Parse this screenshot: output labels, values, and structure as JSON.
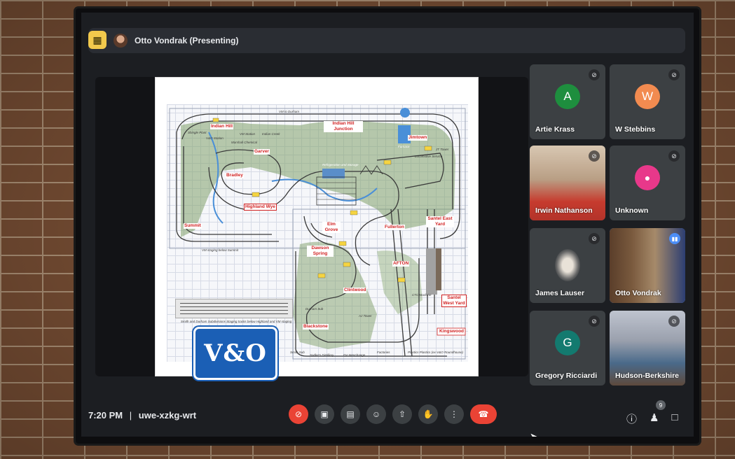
{
  "presenter_bar": {
    "name": "Otto Vondrak (Presenting)"
  },
  "slide": {
    "labels": {
      "indian_hill": "Indian Hill",
      "indian_hill_junction": "Indian Hill Junction",
      "jimtown": "Jimtown",
      "garver": "Garver",
      "bradley": "Bradley",
      "highland_wye": "Highland Wye",
      "summit": "Summit",
      "elm_grove": "Elm Grove",
      "fullerton": "Fullerton",
      "santel_east_yard": "Santel East Yard",
      "dawson_spring": "Dawson Spring",
      "afton": "AFTON",
      "clintwood": "Clintwood",
      "santel_west_yard": "Santel West Yard",
      "blackstone": "Blackstone",
      "kingswood": "Kingswood"
    },
    "notes": {
      "vm_to_durham": "VM to Durham",
      "shingle_plant": "Shingle Plant",
      "vo_station": "V&O Station",
      "vm_station": "VM Station",
      "indian_creek": "Indian Creek",
      "marshall_chemical": "Marshall Chemical",
      "refrigeration": "Refrigeration and Storage",
      "locomotive_service": "Locomotive Service",
      "jt_tower": "JT Tower",
      "furnace": "Furnace",
      "vm_staging": "VM staging below Summit",
      "staging_note": "Smith and Durham Subdivisions Staging tracks below Highland and VM staging",
      "smith_sub": "Smith Sub",
      "sadlers_distillery": "Sadler's Distillery",
      "dv_interchange": "DV Interchange",
      "factories": "Factories",
      "plastics": "Plastics Plastics (ex-V&O Roundhouse)",
      "ctc_machine": "CTC Machine",
      "aj_tower": "AJ Tower",
      "durham_sub": "Durham Sub"
    },
    "logo_text": "V&O"
  },
  "participants": [
    {
      "name": "Artie Krass",
      "initial": "A",
      "color": "#1e8e3e",
      "muted": true
    },
    {
      "name": "W Stebbins",
      "initial": "W",
      "color": "#f28b50",
      "muted": true
    },
    {
      "name": "Irwin Nathanson",
      "muted": true
    },
    {
      "name": "Unknown",
      "color": "#e8388a",
      "muted": true
    },
    {
      "name": "James Lauser",
      "muted": true
    },
    {
      "name": "Otto Vondrak",
      "speaking": true
    },
    {
      "name": "Gregory Ricciardi",
      "initial": "G",
      "color": "#137a6f",
      "muted": true
    },
    {
      "name": "Hudson-Berkshire",
      "muted": true
    }
  ],
  "meeting": {
    "time": "7:20 PM",
    "separator": "|",
    "code": "uwe-xzkg-wrt"
  },
  "people_count": "9",
  "icons": {
    "pin": "pin-icon",
    "mic_off": "mic-off-icon",
    "camera": "camera-icon",
    "captions": "captions-icon",
    "emoji": "emoji-icon",
    "present": "present-icon",
    "hand": "raise-hand-icon",
    "more": "more-icon",
    "hangup": "hangup-icon",
    "info": "info-icon",
    "people": "people-icon",
    "chat": "chat-icon"
  },
  "colors": {
    "accent": "#4c8ef7",
    "danger": "#ea4335",
    "pin_bg": "#f2c94c",
    "tile_bg": "#3c4043"
  }
}
